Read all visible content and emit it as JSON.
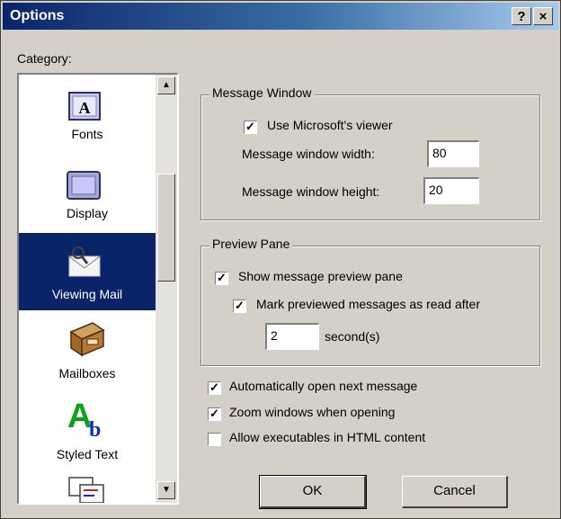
{
  "window": {
    "title": "Options",
    "help_label": "?",
    "close_label": "×"
  },
  "category": {
    "label": "Category:",
    "items": [
      {
        "label": "Fonts",
        "icon": "fonts-icon",
        "selected": false
      },
      {
        "label": "Display",
        "icon": "display-icon",
        "selected": false
      },
      {
        "label": "Viewing Mail",
        "icon": "viewing-mail-icon",
        "selected": true
      },
      {
        "label": "Mailboxes",
        "icon": "mailboxes-icon",
        "selected": false
      },
      {
        "label": "Styled Text",
        "icon": "styled-text-icon",
        "selected": false
      },
      {
        "label": "",
        "icon": "partial-item-icon",
        "selected": false
      }
    ]
  },
  "message_window": {
    "legend": "Message Window",
    "use_viewer_label": "Use Microsoft's viewer",
    "use_viewer_checked": true,
    "width_label": "Message window width:",
    "width_value": "80",
    "height_label": "Message window height:",
    "height_value": "20"
  },
  "preview_pane": {
    "legend": "Preview Pane",
    "show_label": "Show message preview pane",
    "show_checked": true,
    "mark_label": "Mark previewed messages as read after",
    "mark_checked": true,
    "seconds_value": "2",
    "seconds_label": "second(s)"
  },
  "options": {
    "auto_open_label": "Automatically open next message",
    "auto_open_checked": true,
    "zoom_label": "Zoom windows when opening",
    "zoom_checked": true,
    "allow_exec_label": "Allow executables in HTML content",
    "allow_exec_checked": false
  },
  "buttons": {
    "ok": "OK",
    "cancel": "Cancel"
  },
  "colors": {
    "title_bar": "#0a246a",
    "selection": "#0a246a",
    "face": "#d4d0c8"
  }
}
